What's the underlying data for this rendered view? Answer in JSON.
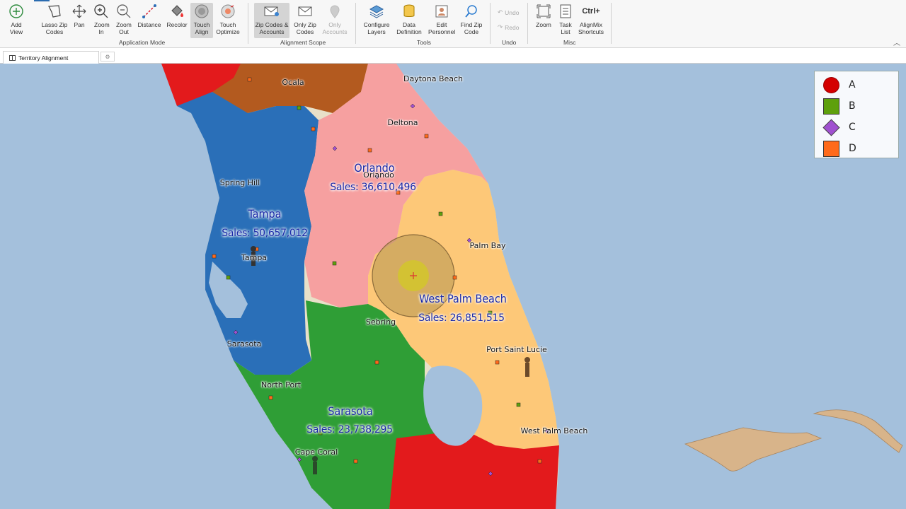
{
  "ribbon": {
    "buttons": [
      {
        "label": "Add View",
        "icon": "add-circle-icon"
      },
      {
        "label": "Lasso Zip Codes",
        "icon": "lasso-icon"
      },
      {
        "label": "Pan",
        "icon": "pan-arrows-icon"
      },
      {
        "label": "Zoom In",
        "icon": "zoom-in-icon"
      },
      {
        "label": "Zoom Out",
        "icon": "zoom-out-icon"
      },
      {
        "label": "Distance",
        "icon": "distance-ruler-icon"
      },
      {
        "label": "Recolor",
        "icon": "paint-bucket-icon"
      },
      {
        "label": "Touch Align",
        "icon": "touch-align-icon"
      },
      {
        "label": "Touch Optimize",
        "icon": "touch-optimize-icon"
      },
      {
        "label": "Zip Codes & Accounts",
        "icon": "envelope-pin-icon"
      },
      {
        "label": "Only Zip Codes",
        "icon": "envelope-icon"
      },
      {
        "label": "Only Accounts",
        "icon": "map-pin-icon"
      },
      {
        "label": "Configure Layers",
        "icon": "layers-icon"
      },
      {
        "label": "Data Definition",
        "icon": "database-icon"
      },
      {
        "label": "Edit Personnel",
        "icon": "personnel-icon"
      },
      {
        "label": "Find Zip Code",
        "icon": "search-icon"
      },
      {
        "label": "Undo",
        "icon": "undo-icon"
      },
      {
        "label": "Redo",
        "icon": "redo-icon"
      },
      {
        "label": "Zoom",
        "icon": "zoom-extent-icon"
      },
      {
        "label": "Task List",
        "icon": "task-list-icon"
      },
      {
        "label": "AlignMix Shortcuts",
        "icon": "keyboard-shortcut-icon",
        "glyph": "Ctrl+"
      }
    ],
    "groups": {
      "application_mode": "Application Mode",
      "alignment_scope": "Alignment Scope",
      "tools": "Tools",
      "undo": "Undo",
      "misc": "Misc"
    }
  },
  "tabs": {
    "active_tab": "Territory Alignment"
  },
  "map": {
    "cities": [
      "Ocala",
      "Daytona Beach",
      "Deltona",
      "Orlando",
      "Spring Hill",
      "Tampa",
      "Palm Bay",
      "Sebring",
      "Port Saint Lucie",
      "Sarasota",
      "North Port",
      "Cape Coral",
      "West Palm Beach"
    ],
    "territories": [
      {
        "name": "Orlando",
        "sales": "Sales:  36,610,496"
      },
      {
        "name": "Tampa",
        "sales": "Sales:  50,657,012"
      },
      {
        "name": "West Palm Beach",
        "sales": "Sales:  26,851,515"
      },
      {
        "name": "Sarasota",
        "sales": "Sales:  23,738,295"
      }
    ],
    "colors": {
      "water": "#a4c0dc",
      "tampa": "#2a6fb8",
      "orlando": "#f6a0a0",
      "west_palm_beach": "#fdc878",
      "sarasota": "#2f9e36",
      "red": "#e31a1c",
      "brown": "#b35a1f"
    }
  },
  "legend": {
    "items": [
      {
        "label": "A",
        "shape": "circle",
        "color": "#d40000"
      },
      {
        "label": "B",
        "shape": "square",
        "color": "#5ea00c"
      },
      {
        "label": "C",
        "shape": "diamond",
        "color": "#a050d0"
      },
      {
        "label": "D",
        "shape": "square",
        "color": "#ff6a1a"
      }
    ]
  }
}
